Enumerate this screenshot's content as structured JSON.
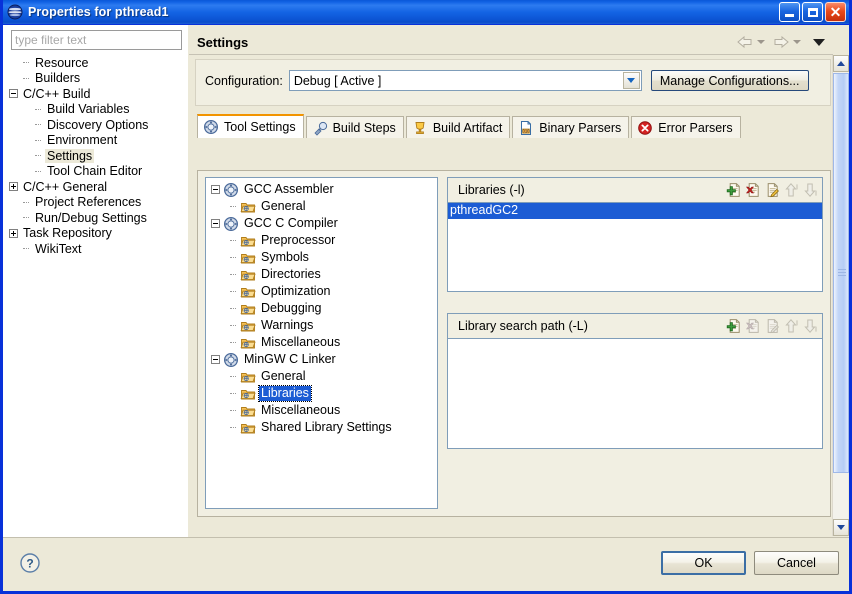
{
  "window": {
    "title": "Properties for pthread1",
    "app_icon": "eclipse-sphere-icon",
    "controls": {
      "minimize": "minimize-button",
      "maximize": "maximize-button",
      "close": "close-button",
      "close_glyph": "✕"
    }
  },
  "left_panel": {
    "filter": {
      "value": "",
      "placeholder": "type filter text"
    },
    "tree": [
      {
        "label": "Resource",
        "depth": 1,
        "marker": "dash"
      },
      {
        "label": "Builders",
        "depth": 1,
        "marker": "dash"
      },
      {
        "label": "C/C++ Build",
        "depth": 0,
        "marker": "minus"
      },
      {
        "label": "Build Variables",
        "depth": 2,
        "marker": "dash"
      },
      {
        "label": "Discovery Options",
        "depth": 2,
        "marker": "dash"
      },
      {
        "label": "Environment",
        "depth": 2,
        "marker": "dash"
      },
      {
        "label": "Settings",
        "depth": 2,
        "marker": "dash",
        "selected": true
      },
      {
        "label": "Tool Chain Editor",
        "depth": 2,
        "marker": "dash"
      },
      {
        "label": "C/C++ General",
        "depth": 0,
        "marker": "plus"
      },
      {
        "label": "Project References",
        "depth": 1,
        "marker": "dash"
      },
      {
        "label": "Run/Debug Settings",
        "depth": 1,
        "marker": "dash"
      },
      {
        "label": "Task Repository",
        "depth": 0,
        "marker": "plus"
      },
      {
        "label": "WikiText",
        "depth": 1,
        "marker": "dash"
      }
    ]
  },
  "header": {
    "title": "Settings",
    "back_icon": "back-arrow-icon",
    "forward_icon": "forward-arrow-icon",
    "menu_icon": "view-menu-chevron-icon"
  },
  "configuration": {
    "label": "Configuration:",
    "selected": "Debug  [ Active ]",
    "options": [
      "Debug  [ Active ]"
    ],
    "manage_button": "Manage Configurations..."
  },
  "tabs": [
    {
      "label": "Tool Settings",
      "icon": "tool-settings-icon",
      "active": true
    },
    {
      "label": "Build Steps",
      "icon": "build-steps-icon",
      "active": false
    },
    {
      "label": "Build Artifact",
      "icon": "build-artifact-icon",
      "active": false
    },
    {
      "label": "Binary Parsers",
      "icon": "binary-parsers-icon",
      "active": false
    },
    {
      "label": "Error Parsers",
      "icon": "error-parsers-icon",
      "active": false
    }
  ],
  "tool_tree": [
    {
      "label": "GCC Assembler",
      "depth": 0,
      "expander": "minus",
      "icon": "tool-icon"
    },
    {
      "label": "General",
      "depth": 1,
      "expander": "none",
      "icon": "folder-icon"
    },
    {
      "label": "GCC C Compiler",
      "depth": 0,
      "expander": "minus",
      "icon": "tool-icon"
    },
    {
      "label": "Preprocessor",
      "depth": 1,
      "expander": "none",
      "icon": "folder-icon"
    },
    {
      "label": "Symbols",
      "depth": 1,
      "expander": "none",
      "icon": "folder-icon"
    },
    {
      "label": "Directories",
      "depth": 1,
      "expander": "none",
      "icon": "folder-icon"
    },
    {
      "label": "Optimization",
      "depth": 1,
      "expander": "none",
      "icon": "folder-icon"
    },
    {
      "label": "Debugging",
      "depth": 1,
      "expander": "none",
      "icon": "folder-icon"
    },
    {
      "label": "Warnings",
      "depth": 1,
      "expander": "none",
      "icon": "folder-icon"
    },
    {
      "label": "Miscellaneous",
      "depth": 1,
      "expander": "none",
      "icon": "folder-icon"
    },
    {
      "label": "MinGW C Linker",
      "depth": 0,
      "expander": "minus",
      "icon": "tool-icon"
    },
    {
      "label": "General",
      "depth": 1,
      "expander": "none",
      "icon": "folder-icon"
    },
    {
      "label": "Libraries",
      "depth": 1,
      "expander": "none",
      "icon": "folder-icon",
      "selected": true
    },
    {
      "label": "Miscellaneous",
      "depth": 1,
      "expander": "none",
      "icon": "folder-icon"
    },
    {
      "label": "Shared Library Settings",
      "depth": 1,
      "expander": "none",
      "icon": "folder-icon"
    }
  ],
  "panels": [
    {
      "title": "Libraries (-l)",
      "items": [
        {
          "text": "pthreadGC2",
          "selected": true
        }
      ],
      "toolbar": [
        {
          "name": "add-icon",
          "enabled": true
        },
        {
          "name": "delete-icon",
          "enabled": true
        },
        {
          "name": "edit-icon",
          "enabled": true
        },
        {
          "name": "move-up-icon",
          "enabled": false
        },
        {
          "name": "move-down-icon",
          "enabled": false
        }
      ]
    },
    {
      "title": "Library search path (-L)",
      "items": [],
      "toolbar": [
        {
          "name": "add-icon",
          "enabled": true
        },
        {
          "name": "delete-icon",
          "enabled": false
        },
        {
          "name": "edit-icon",
          "enabled": false
        },
        {
          "name": "move-up-icon",
          "enabled": false
        },
        {
          "name": "move-down-icon",
          "enabled": false
        }
      ]
    }
  ],
  "footer": {
    "help_icon": "help-question-icon",
    "ok_label": "OK",
    "cancel_label": "Cancel"
  },
  "colors": {
    "titlebar_blue": "#0a57d8",
    "frame_blue": "#0831d9",
    "selection_blue": "#1c5cd4",
    "active_tab_accent": "#f29400",
    "dialog_bg": "#ece9d8",
    "panel_border": "#7f9db9",
    "close_red": "#e94a1b"
  }
}
